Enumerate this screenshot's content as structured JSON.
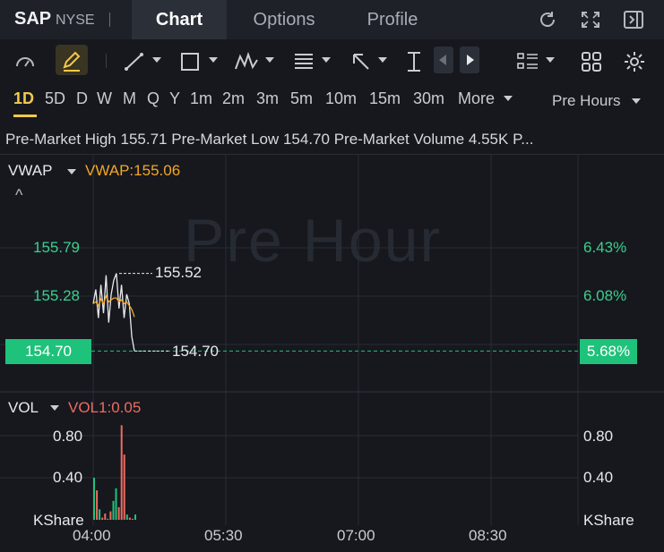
{
  "header": {
    "ticker": "SAP",
    "exchange": "NYSE",
    "tabs": [
      {
        "label": "Chart",
        "active": true
      },
      {
        "label": "Options",
        "active": false
      },
      {
        "label": "Profile",
        "active": false
      }
    ],
    "icons": [
      "refresh-icon",
      "fullscreen-icon",
      "collapse-panel-icon"
    ]
  },
  "toolbar": {
    "icons": [
      "gauge-icon",
      "draw-pencil-icon",
      "trend-line-icon",
      "rectangle-icon",
      "pattern-icon",
      "fib-icon",
      "arrow-icon",
      "measure-icon",
      "scroll-left-icon",
      "scroll-right-icon",
      "indicators-list-icon",
      "layout-grid-icon",
      "settings-gear-icon"
    ]
  },
  "periods": {
    "items": [
      "1D",
      "5D",
      "D",
      "W",
      "M",
      "Q",
      "Y",
      "1m",
      "2m",
      "3m",
      "5m",
      "10m",
      "15m",
      "30m"
    ],
    "active": "1D",
    "more_label": "More",
    "session_label": "Pre Hours"
  },
  "info": {
    "high_label": "Pre-Market High",
    "high_value": "155.71",
    "low_label": "Pre-Market Low",
    "low_value": "154.70",
    "volume_label": "Pre-Market Volume",
    "volume_value": "4.55K",
    "truncated": "P..."
  },
  "indicators": {
    "vwap_name": "VWAP",
    "vwap_value": "VWAP:155.06",
    "vol_name": "VOL",
    "vol_value": "VOL1:0.05",
    "collapse_glyph": "^"
  },
  "watermark": "Pre Hour",
  "colors": {
    "up": "#1ec27a",
    "down": "#ef6b5f",
    "vwap": "#f5a623",
    "accent": "#f2c94c"
  },
  "chart_data": {
    "type": "line",
    "price_ticks_left": [
      "155.79",
      "155.28"
    ],
    "price_ticks_right": [
      "6.43%",
      "6.08%"
    ],
    "current_price": "154.70",
    "current_pct": "5.68%",
    "high_marker": "155.52",
    "low_marker": "154.70",
    "volume_ticks": [
      "0.80",
      "0.40"
    ],
    "volume_unit": "KShare",
    "x_ticks": [
      "04:00",
      "05:30",
      "07:00",
      "08:30"
    ],
    "price_series": [
      155.2,
      155.35,
      155.05,
      155.4,
      155.1,
      155.5,
      155.0,
      155.3,
      155.45,
      155.52,
      155.15,
      155.4,
      155.05,
      155.3,
      155.2,
      154.85,
      154.7
    ],
    "vwap_series": [
      155.2,
      155.22,
      155.18,
      155.25,
      155.2,
      155.28,
      155.22,
      155.24,
      155.26,
      155.26,
      155.22,
      155.24,
      155.2,
      155.22,
      155.18,
      155.14,
      155.06
    ],
    "volumes": [
      0.4,
      0.28,
      0.1,
      0.02,
      0.06,
      0.01,
      0.08,
      0.18,
      0.3,
      0.12,
      0.9,
      0.62,
      0.05,
      0.02,
      0.01,
      0.05
    ],
    "volume_colors": [
      "up",
      "down",
      "up",
      "down",
      "down",
      "up",
      "down",
      "up",
      "up",
      "down",
      "down",
      "down",
      "up",
      "down",
      "down",
      "up"
    ]
  }
}
